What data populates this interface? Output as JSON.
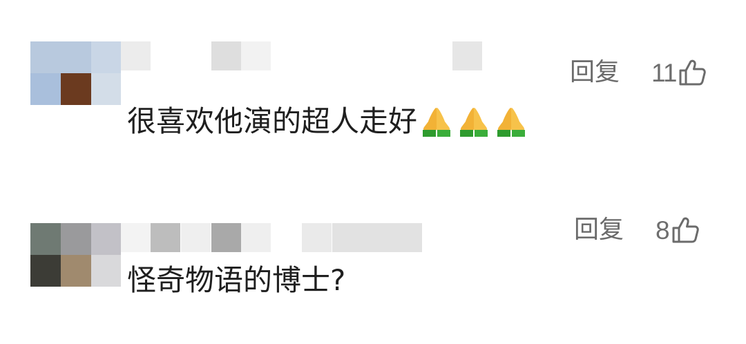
{
  "comments": [
    {
      "text": "很喜欢他演的超人走好",
      "emoji": "folded-hands",
      "emoji_count": 3,
      "reply_label": "回复",
      "like_count": "11"
    },
    {
      "text": "怪奇物语的博士?",
      "reply_label": "回复",
      "like_count": "8"
    }
  ],
  "colors": {
    "action_text": "#6b6b6b",
    "comment_text": "#1f1f1f",
    "background": "#ffffff"
  }
}
